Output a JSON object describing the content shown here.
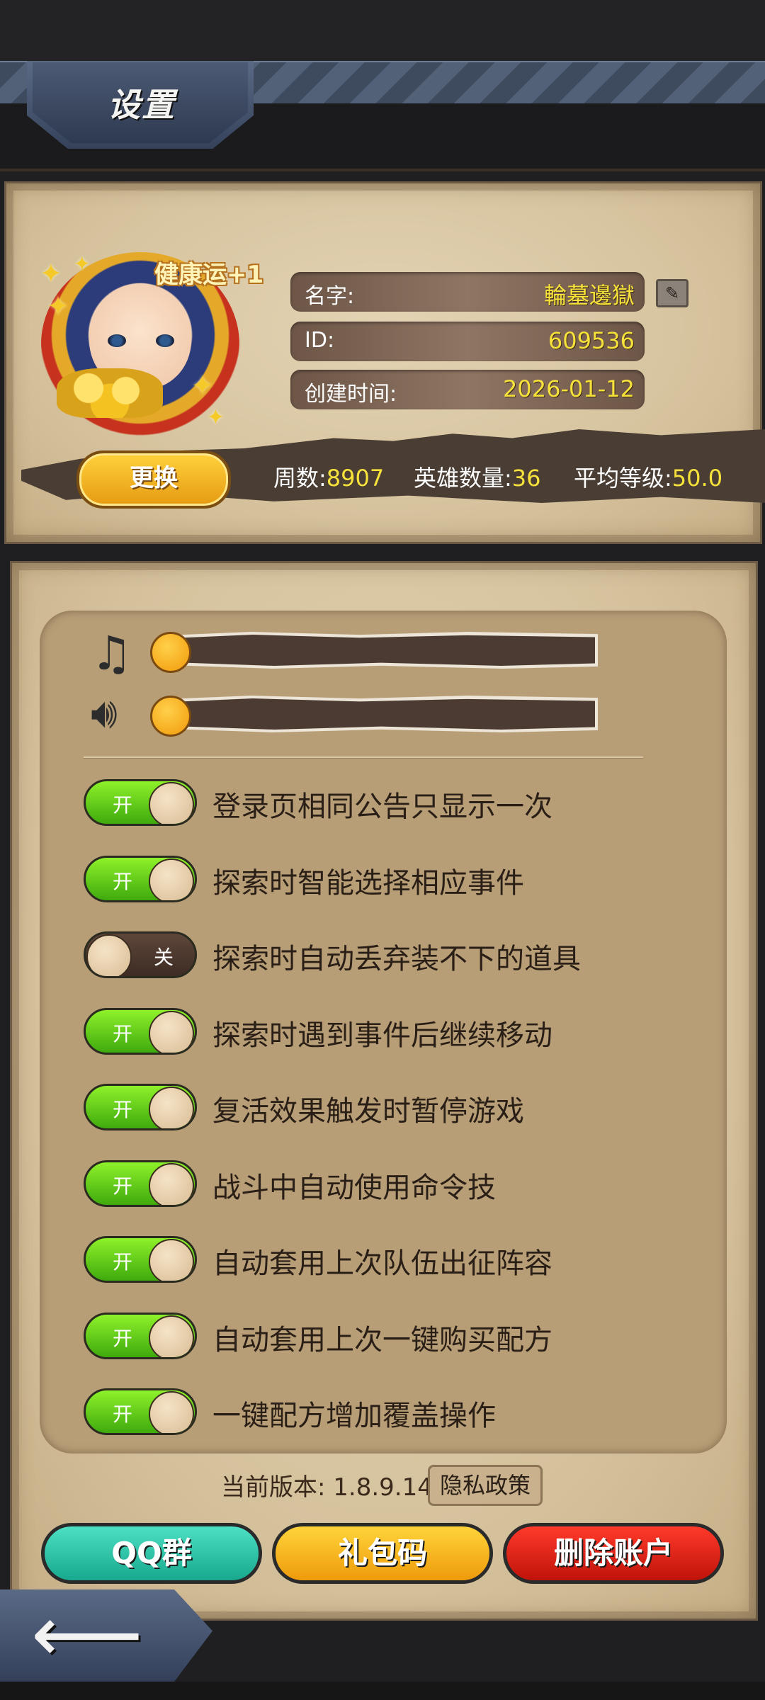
{
  "header": {
    "title": "设置"
  },
  "profile": {
    "fortune_tag": "健康运+1",
    "name_label": "名字:",
    "name_value": "輪墓邊獄",
    "id_label": "ID:",
    "id_value": "609536",
    "created_label": "创建时间:",
    "created_value": "2026-01-12",
    "change_button": "更换",
    "stats": {
      "weeks_label": "周数:",
      "weeks_value": "8907",
      "heroes_label": "英雄数量:",
      "heroes_value": "36",
      "avg_level_label": "平均等级:",
      "avg_level_value": "50.0"
    }
  },
  "audio": {
    "music_icon": "music-note-icon",
    "sound_icon": "speaker-icon",
    "music_level": 0,
    "sound_level": 0
  },
  "toggles": {
    "on_text": "开",
    "off_text": "关",
    "items": [
      {
        "label": "登录页相同公告只显示一次",
        "state": "on"
      },
      {
        "label": "探索时智能选择相应事件",
        "state": "on"
      },
      {
        "label": "探索时自动丢弃装不下的道具",
        "state": "off"
      },
      {
        "label": "探索时遇到事件后继续移动",
        "state": "on"
      },
      {
        "label": "复活效果触发时暂停游戏",
        "state": "on"
      },
      {
        "label": "战斗中自动使用命令技",
        "state": "on"
      },
      {
        "label": "自动套用上次队伍出征阵容",
        "state": "on"
      },
      {
        "label": "自动套用上次一键购买配方",
        "state": "on"
      },
      {
        "label": "一键配方增加覆盖操作",
        "state": "on"
      }
    ]
  },
  "footer": {
    "version_text": "当前版本: 1.8.9.14",
    "privacy_button": "隐私政策",
    "qq_button": "QQ群",
    "gift_button": "礼包码",
    "delete_button": "删除账户"
  },
  "colors": {
    "accent_yellow": "#f6e23a",
    "toggle_on": "#5fd316",
    "toggle_off": "#4a362c",
    "parchment": "#d6c39e"
  }
}
